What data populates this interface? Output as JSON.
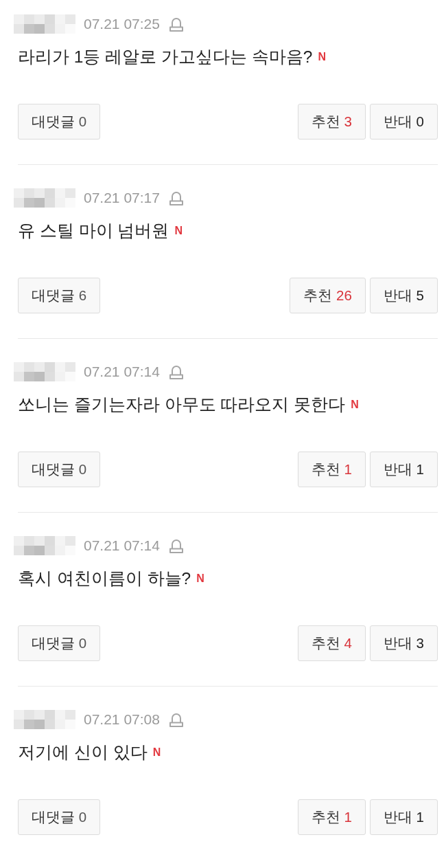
{
  "comments": [
    {
      "time": "07.21 07:25",
      "text": "라리가 1등 레알로 가고싶다는 속마음?",
      "new_badge": "N",
      "reply_button": {
        "label": "대댓글",
        "count": "0"
      },
      "recommend_button": {
        "label": "추천",
        "count": "3"
      },
      "oppose_button": {
        "label": "반대",
        "count": "0"
      }
    },
    {
      "time": "07.21 07:17",
      "text": "유 스틸 마이 넘버원",
      "new_badge": "N",
      "reply_button": {
        "label": "대댓글",
        "count": "6"
      },
      "recommend_button": {
        "label": "추천",
        "count": "26"
      },
      "oppose_button": {
        "label": "반대",
        "count": "5"
      }
    },
    {
      "time": "07.21 07:14",
      "text": "쏘니는 즐기는자라 아무도 따라오지 못한다",
      "new_badge": "N",
      "reply_button": {
        "label": "대댓글",
        "count": "0"
      },
      "recommend_button": {
        "label": "추천",
        "count": "1"
      },
      "oppose_button": {
        "label": "반대",
        "count": "1"
      }
    },
    {
      "time": "07.21 07:14",
      "text": "혹시 여친이름이 하늘?",
      "new_badge": "N",
      "reply_button": {
        "label": "대댓글",
        "count": "0"
      },
      "recommend_button": {
        "label": "추천",
        "count": "4"
      },
      "oppose_button": {
        "label": "반대",
        "count": "3"
      }
    },
    {
      "time": "07.21 07:08",
      "text": "저기에 신이 있다",
      "new_badge": "N",
      "reply_button": {
        "label": "대댓글",
        "count": "0"
      },
      "recommend_button": {
        "label": "추천",
        "count": "1"
      },
      "oppose_button": {
        "label": "반대",
        "count": "1"
      }
    }
  ]
}
